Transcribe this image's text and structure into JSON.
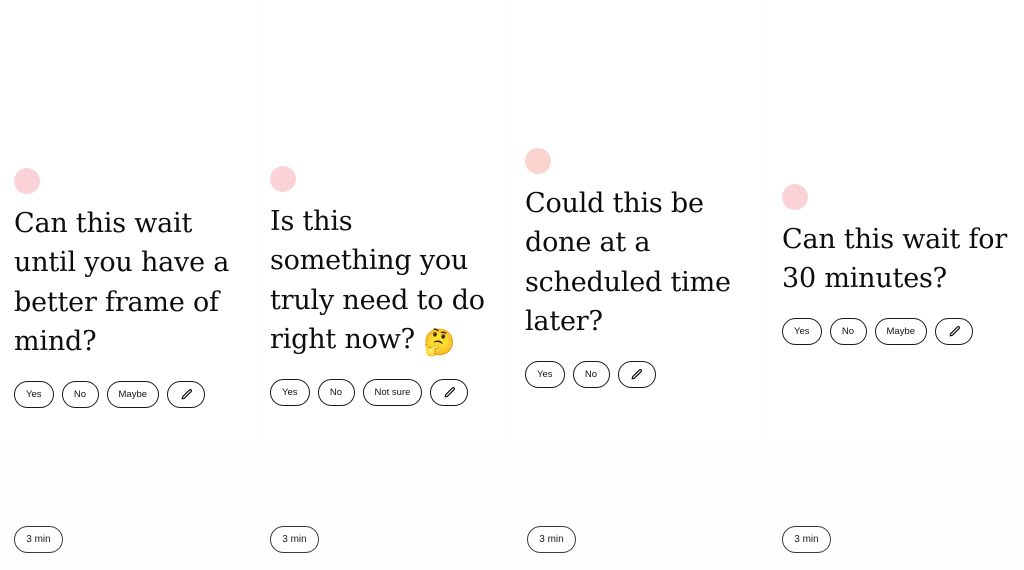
{
  "page": {
    "background_color": "#ffffff",
    "accent_dot_color": "#fbd2d7",
    "text_color": "#0d0d0d"
  },
  "cards": [
    {
      "dot": "status-dot",
      "question": "Can this wait until you have a better frame of mind?",
      "emoji": "",
      "answers": [
        "Yes",
        "No",
        "Maybe"
      ],
      "edit_icon": "pencil-icon",
      "duration": "3 min"
    },
    {
      "dot": "status-dot",
      "question": "Is this something you truly need to do right now? ",
      "emoji": "🤔",
      "answers": [
        "Yes",
        "No",
        "Not sure"
      ],
      "edit_icon": "pencil-icon",
      "duration": "3 min"
    },
    {
      "dot": "status-dot",
      "question": "Could this be done at a scheduled time later?",
      "emoji": "",
      "answers": [
        "Yes",
        "No"
      ],
      "edit_icon": "pencil-icon",
      "duration": "3 min"
    },
    {
      "dot": "status-dot",
      "question": "Can this wait for 30 minutes?",
      "emoji": "",
      "answers": [
        "Yes",
        "No",
        "Maybe"
      ],
      "edit_icon": "pencil-icon",
      "duration": "3 min"
    }
  ]
}
